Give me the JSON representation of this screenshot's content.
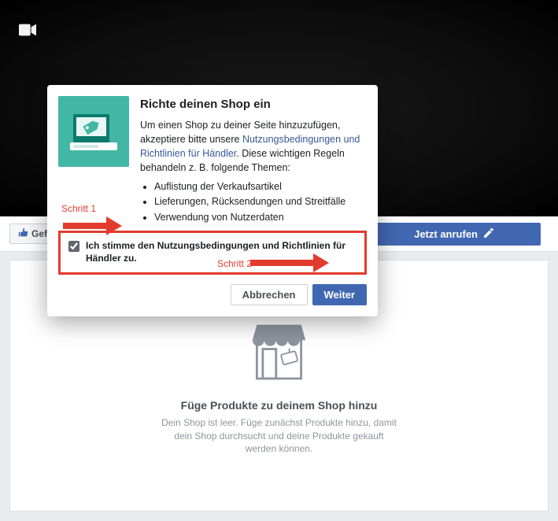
{
  "cover": {
    "camera_icon": "video-camera-icon"
  },
  "toolbar": {
    "like_label": "Gefä",
    "call_label": "Jetzt anrufen"
  },
  "shop_empty": {
    "title": "Füge Produkte zu deinem Shop hinzu",
    "text": "Dein Shop ist leer. Füge zunächst Produkte hinzu, damit dein Shop durchsucht und deine Produkte gekauft werden können."
  },
  "modal": {
    "title": "Richte deinen Shop ein",
    "intro_prefix": "Um einen Shop zu deiner Seite hinzuzufügen, akzeptiere bitte unsere ",
    "link_text": "Nutzungsbedingungen und Richtlinien für Händler",
    "intro_suffix": ". Diese wichtigen Regeln behandeln z. B. folgende Themen:",
    "bullets": [
      "Auflistung der Verkaufsartikel",
      "Lieferungen, Rücksendungen und Streitfälle",
      "Verwendung von Nutzerdaten"
    ],
    "agree_label": "Ich stimme den Nutzungsbedingungen und Richtlinien für Händler zu.",
    "cancel": "Abbrechen",
    "continue": "Weiter"
  },
  "annotations": {
    "step1": "Schritt 1",
    "step2": "Schritt 2"
  }
}
